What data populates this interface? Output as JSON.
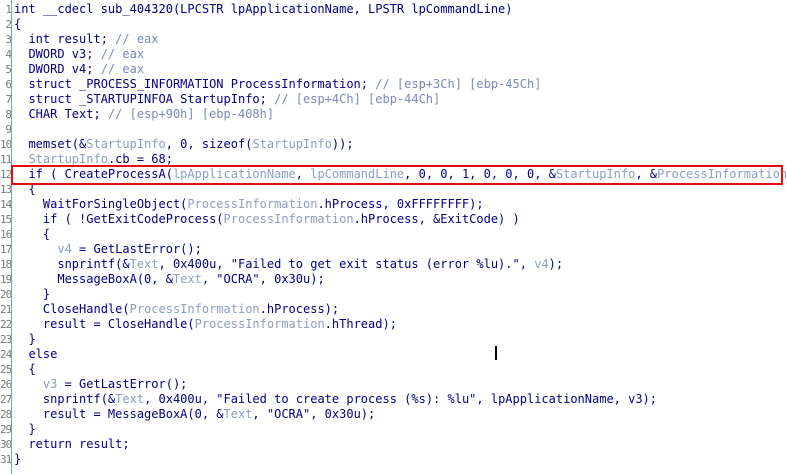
{
  "lines": [
    {
      "n": "1",
      "parts": [
        [
          "int __cdecl sub_404320(LPCSTR lpApplicationName, LPSTR lpCommandLine)",
          "n"
        ]
      ]
    },
    {
      "n": "2",
      "parts": [
        [
          "{",
          "n"
        ]
      ]
    },
    {
      "n": "3",
      "parts": [
        [
          "  int result; ",
          "n"
        ],
        [
          "// eax",
          "c"
        ]
      ]
    },
    {
      "n": "4",
      "parts": [
        [
          "  DWORD v3; ",
          "n"
        ],
        [
          "// eax",
          "c"
        ]
      ]
    },
    {
      "n": "5",
      "parts": [
        [
          "  DWORD v4; ",
          "n"
        ],
        [
          "// eax",
          "c"
        ]
      ]
    },
    {
      "n": "6",
      "parts": [
        [
          "  struct _PROCESS_INFORMATION ProcessInformation; ",
          "n"
        ],
        [
          "// [esp+3Ch] [ebp-45Ch]",
          "c"
        ]
      ]
    },
    {
      "n": "7",
      "parts": [
        [
          "  struct _STARTUPINFOA StartupInfo; ",
          "n"
        ],
        [
          "// [esp+4Ch] [ebp-44Ch]",
          "c"
        ]
      ]
    },
    {
      "n": "8",
      "parts": [
        [
          "  CHAR Text; ",
          "n"
        ],
        [
          "// [esp+90h] [ebp-408h]",
          "c"
        ]
      ]
    },
    {
      "n": "9",
      "parts": [
        [
          "",
          "n"
        ]
      ]
    },
    {
      "n": "10",
      "parts": [
        [
          "  memset(&",
          "n"
        ],
        [
          "StartupInfo",
          "v"
        ],
        [
          ", 0, sizeof(",
          "n"
        ],
        [
          "StartupInfo",
          "v"
        ],
        [
          "));",
          "n"
        ]
      ]
    },
    {
      "n": "11",
      "parts": [
        [
          "  ",
          "n"
        ],
        [
          "StartupInfo",
          "v"
        ],
        [
          ".cb = 68;",
          "n"
        ]
      ]
    },
    {
      "n": "12",
      "parts": [
        [
          "  if ( CreateProcessA(",
          "n"
        ],
        [
          "lpApplicationName",
          "v"
        ],
        [
          ", ",
          "n"
        ],
        [
          "lpCommandLine",
          "v"
        ],
        [
          ", 0, 0, 1, 0, 0, 0, &",
          "n"
        ],
        [
          "StartupInfo",
          "v"
        ],
        [
          ", &",
          "n"
        ],
        [
          "ProcessInformation",
          "v"
        ],
        [
          ") )",
          "n"
        ]
      ]
    },
    {
      "n": "13",
      "parts": [
        [
          "  {",
          "n"
        ]
      ]
    },
    {
      "n": "14",
      "parts": [
        [
          "    WaitForSingleObject(",
          "n"
        ],
        [
          "ProcessInformation",
          "v"
        ],
        [
          ".hProcess, 0xFFFFFFFF);",
          "n"
        ]
      ]
    },
    {
      "n": "15",
      "parts": [
        [
          "    if ( !GetExitCodeProcess(",
          "n"
        ],
        [
          "ProcessInformation",
          "v"
        ],
        [
          ".hProcess, &ExitCode) )",
          "n"
        ]
      ]
    },
    {
      "n": "16",
      "parts": [
        [
          "    {",
          "n"
        ]
      ]
    },
    {
      "n": "17",
      "parts": [
        [
          "      ",
          "n"
        ],
        [
          "v4",
          "v"
        ],
        [
          " = GetLastError();",
          "n"
        ]
      ]
    },
    {
      "n": "18",
      "parts": [
        [
          "      snprintf(&",
          "n"
        ],
        [
          "Text",
          "v"
        ],
        [
          ", 0x400u, \"Failed to get exit status (error %lu).\", ",
          "n"
        ],
        [
          "v4",
          "v"
        ],
        [
          ");",
          "n"
        ]
      ]
    },
    {
      "n": "19",
      "parts": [
        [
          "      MessageBoxA(0, &",
          "n"
        ],
        [
          "Text",
          "v"
        ],
        [
          ", \"OCRA\", 0x30u);",
          "n"
        ]
      ]
    },
    {
      "n": "20",
      "parts": [
        [
          "    }",
          "n"
        ]
      ]
    },
    {
      "n": "21",
      "parts": [
        [
          "    CloseHandle(",
          "n"
        ],
        [
          "ProcessInformation",
          "v"
        ],
        [
          ".hProcess);",
          "n"
        ]
      ]
    },
    {
      "n": "22",
      "parts": [
        [
          "    result = CloseHandle(",
          "n"
        ],
        [
          "ProcessInformation",
          "v"
        ],
        [
          ".hThread);",
          "n"
        ]
      ]
    },
    {
      "n": "23",
      "parts": [
        [
          "  }",
          "n"
        ]
      ]
    },
    {
      "n": "24",
      "parts": [
        [
          "  else",
          "n"
        ]
      ]
    },
    {
      "n": "25",
      "parts": [
        [
          "  {",
          "n"
        ]
      ]
    },
    {
      "n": "26",
      "parts": [
        [
          "    ",
          "n"
        ],
        [
          "v3",
          "v"
        ],
        [
          " = GetLastError();",
          "n"
        ]
      ]
    },
    {
      "n": "27",
      "parts": [
        [
          "    snprintf(&",
          "n"
        ],
        [
          "Text",
          "v"
        ],
        [
          ", 0x400u, \"Failed to create process (%s): %lu\", lpApplicationName, v3);",
          "n"
        ]
      ]
    },
    {
      "n": "28",
      "parts": [
        [
          "    result = MessageBoxA(0, &",
          "n"
        ],
        [
          "Text",
          "v"
        ],
        [
          ", \"OCRA\", 0x30u);",
          "n"
        ]
      ]
    },
    {
      "n": "29",
      "parts": [
        [
          "  }",
          "n"
        ]
      ]
    },
    {
      "n": "30",
      "parts": [
        [
          "  return result;",
          "n"
        ]
      ]
    },
    {
      "n": "31",
      "parts": [
        [
          "}",
          "n"
        ]
      ]
    }
  ],
  "colors": {
    "keyword": "#000080",
    "variable": "#8aa0c0",
    "comment": "#7a8ab8",
    "highlight_border": "#e01010"
  }
}
